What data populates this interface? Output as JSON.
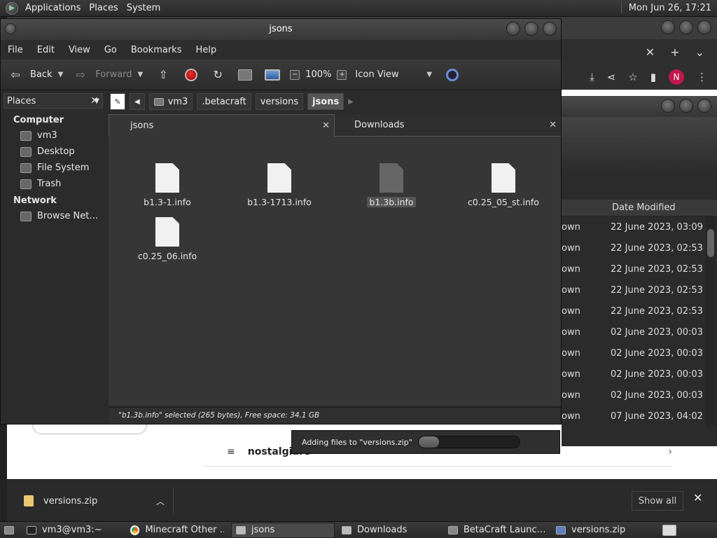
{
  "top_panel": {
    "menus": [
      "Applications",
      "Places",
      "System"
    ],
    "clock": "Mon Jun 26, 17:21"
  },
  "browser_bg": {
    "tab_controls": {
      "close": "✕",
      "new_tab": "+",
      "dropdown": "⌄"
    },
    "avatar_letter": "N",
    "page_row_text": "nostalgiare",
    "download_chip": "versions.zip",
    "show_all": "Show all"
  },
  "downloads_window": {
    "column_header": "Date Modified",
    "rows": [
      {
        "owner": "own",
        "date": "22 June 2023, 03:09"
      },
      {
        "owner": "own",
        "date": "22 June 2023, 02:53"
      },
      {
        "owner": "own",
        "date": "22 June 2023, 02:53"
      },
      {
        "owner": "own",
        "date": "22 June 2023, 02:53"
      },
      {
        "owner": "own",
        "date": "22 June 2023, 02:53"
      },
      {
        "owner": "own",
        "date": "02 June 2023, 00:03"
      },
      {
        "owner": "own",
        "date": "02 June 2023, 00:03"
      },
      {
        "owner": "own",
        "date": "02 June 2023, 00:03"
      },
      {
        "owner": "own",
        "date": "02 June 2023, 00:03"
      },
      {
        "owner": "own",
        "date": "07 June 2023, 04:02"
      }
    ]
  },
  "progress": {
    "text": "Adding files to \"versions.zip\"",
    "fraction": 0.2
  },
  "file_manager": {
    "title": "jsons",
    "menubar": [
      "File",
      "Edit",
      "View",
      "Go",
      "Bookmarks",
      "Help"
    ],
    "toolbar": {
      "back": "Back",
      "forward": "Forward",
      "zoom": "100%",
      "view_mode": "Icon View"
    },
    "sidebar": {
      "header": "Places",
      "sections": [
        {
          "title": "Computer",
          "items": [
            "vm3",
            "Desktop",
            "File System",
            "Trash"
          ]
        },
        {
          "title": "Network",
          "items": [
            "Browse Net…"
          ]
        }
      ]
    },
    "path": [
      "vm3",
      ".betacraft",
      "versions",
      "jsons"
    ],
    "tabs": [
      "jsons",
      "Downloads"
    ],
    "files": [
      {
        "name": "b1.3-1.info",
        "selected": false
      },
      {
        "name": "b1.3-1713.info",
        "selected": false
      },
      {
        "name": "b1.3b.info",
        "selected": true
      },
      {
        "name": "c0.25_05_st.info",
        "selected": false
      },
      {
        "name": "c0.25_06.info",
        "selected": false
      }
    ],
    "status": "\"b1.3b.info\" selected (265 bytes), Free space: 34.1 GB"
  },
  "taskbar": [
    {
      "label": "vm3@vm3:~",
      "icon": "terminal-icon",
      "active": false
    },
    {
      "label": "Minecraft Other …",
      "icon": "chrome-icon",
      "active": false
    },
    {
      "label": "jsons",
      "icon": "folder-icon",
      "active": true
    },
    {
      "label": "Downloads",
      "icon": "folder-icon",
      "active": false
    },
    {
      "label": "BetaCraft Launc…",
      "icon": "java-icon",
      "active": false
    },
    {
      "label": "versions.zip",
      "icon": "archive-icon",
      "active": false
    }
  ],
  "colors": {
    "selection": "#555555",
    "avatar": "#c0174e",
    "stop": "#dd3333"
  }
}
